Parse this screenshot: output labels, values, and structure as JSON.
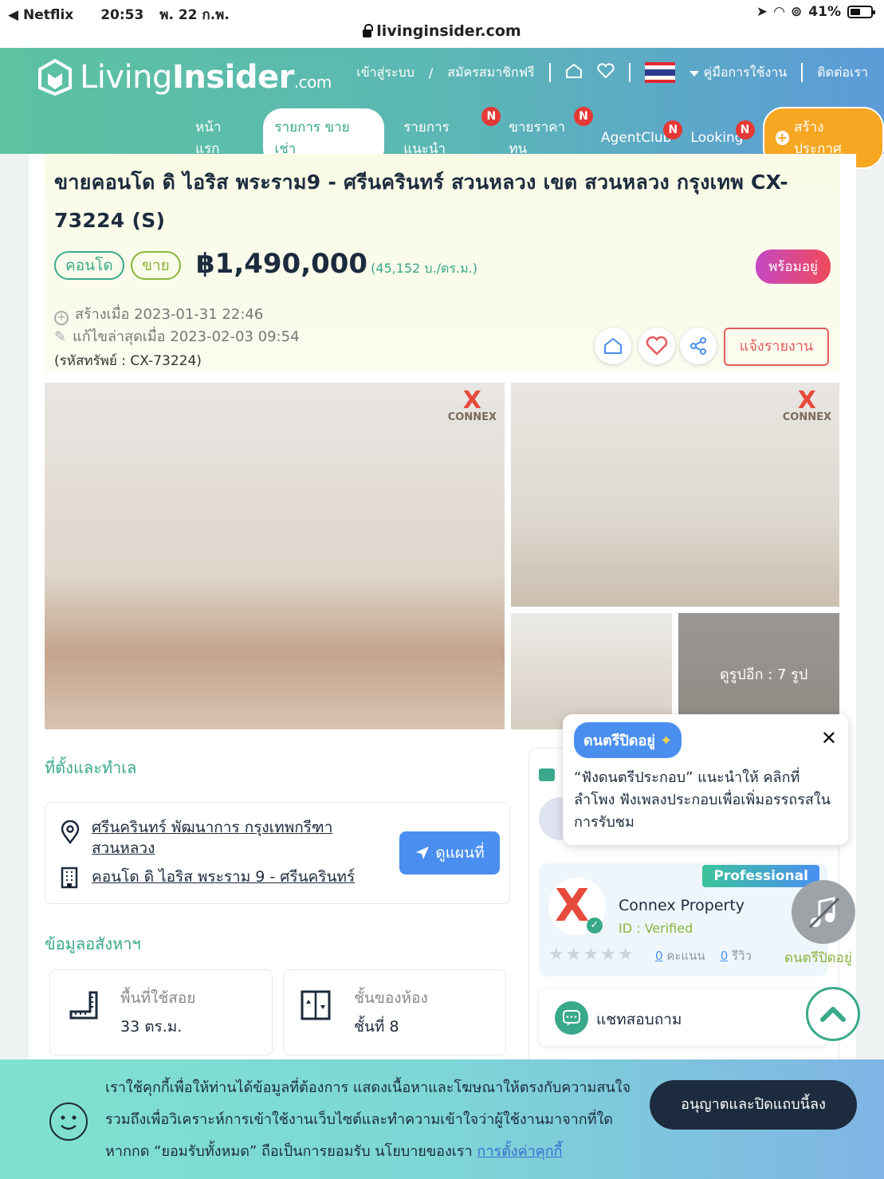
{
  "status_bar": {
    "back_app": "Netflix",
    "time": "20:53",
    "date": "พ. 22 ก.พ.",
    "battery": "41%"
  },
  "address_bar": {
    "url": "livinginsider.com"
  },
  "header": {
    "logo_text_light": "Living",
    "logo_text_bold": "Insider",
    "logo_text_suffix": ".com",
    "top_links": {
      "login": "เข้าสู่ระบบ",
      "slash": "/",
      "register": "สมัครสมาชิกฟรี",
      "manual": "คู่มือการใช้งาน",
      "contact": "ติดต่อเรา"
    },
    "nav": [
      {
        "label": "หน้าแรก",
        "badge": ""
      },
      {
        "label": "รายการ ขาย เช่า",
        "badge": ""
      },
      {
        "label": "รายการแนะนำ",
        "badge": "N"
      },
      {
        "label": "ขายราคาทุน",
        "badge": "N"
      },
      {
        "label": "AgentClub",
        "badge": "N"
      },
      {
        "label": "Looking",
        "badge": "N"
      }
    ],
    "create_button": "สร้างประกาศ"
  },
  "listing": {
    "title": "ขายคอนโด ดิ ไอริส พระราม9 - ศรีนครินทร์ สวนหลวง เขต สวนหลวง กรุงเทพ CX-73224 (S)",
    "tag_type": "คอนโด",
    "tag_deal": "ขาย",
    "price": "฿1,490,000",
    "unit_price": "(45,152 บ./ตร.ม.)",
    "ready_badge": "พร้อมอยู่",
    "created": "สร้างเมื่อ 2023-01-31 22:46",
    "edited": "แก้ไขล่าสุดเมื่อ 2023-02-03 09:54",
    "property_id": "(รหัสทรัพย์ : CX-73224)",
    "report_button": "แจ้งรายงาน"
  },
  "gallery": {
    "more_photos": "ดูรูปอีก : 7 รูป",
    "watermark": "CONNEX"
  },
  "location": {
    "section_title": "ที่ตั้งและทำเล",
    "area_line1": "ศรีนครินทร์ พัฒนาการ กรุงเทพกรีฑา",
    "area_line2": "สวนหลวง",
    "project": "คอนโด ดิ ไอริส พระราม 9 - ศรีนครินทร์",
    "map_button": "ดูแผนที่"
  },
  "property_info": {
    "section_title": "ข้อมูลอสังหาฯ",
    "area_label": "พื้นที่ใช้สอย",
    "area_value": "33 ตร.ม.",
    "floor_label": "ชั้นของห้อง",
    "floor_value": "ชั้นที่ 8"
  },
  "music_popup": {
    "tag": "ดนตรีปิดอยู่",
    "text": "“ฟังดนตรีประกอบ” แนะนำให้ คลิกที่ลำโพง ฟังเพลงประกอบเพื่อเพิ่มอรรถรสในการรับชม",
    "fab_label": "ดนตรีปิดอยู่"
  },
  "agent": {
    "badge": "Professional",
    "name": "Connex Property",
    "id_text": "ID : Verified",
    "score_count": "0",
    "score_unit": "คะแนน",
    "review_count": "0",
    "review_unit": "รีวิว",
    "chat_label": "แชทสอบถาม"
  },
  "cookie": {
    "text": "เราใช้คุกกี้เพื่อให้ท่านได้ข้อมูลที่ต้องการ แสดงเนื้อหาและโฆษณาให้ตรงกับความสนใจ รวมถึงเพื่อวิเคราะห์การเข้าใช้งานเว็บไซต์และทำความเข้าใจว่าผู้ใช้งานมาจากที่ใด หากกด “ยอมรับทั้งหมด” ถือเป็นการยอมรับ นโยบายของเรา",
    "link": "การตั้งค่าคุกกี้",
    "button": "อนุญาตและปิดแถบนี้ลง"
  },
  "colors": {
    "brand_green": "#3aa98b",
    "accent_orange": "#f7a722",
    "link_blue": "#4a8ff0",
    "report_red": "#e35d5d"
  }
}
